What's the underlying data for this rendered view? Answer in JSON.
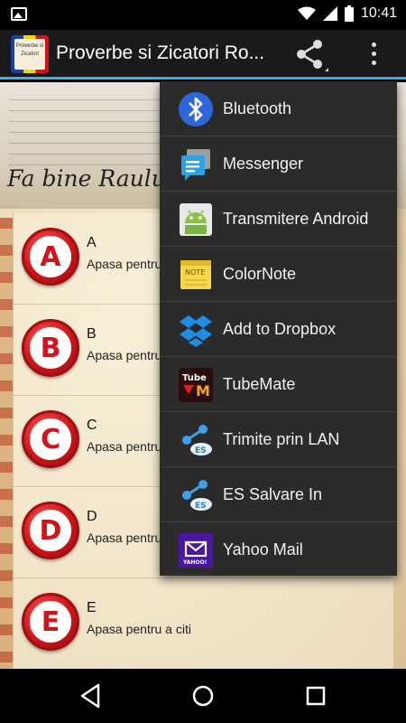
{
  "status_bar": {
    "time": "10:41"
  },
  "app": {
    "title": "Proverbe si Zicatori Ro...",
    "icon_text": "Proverbe si Zicatori"
  },
  "banner": {
    "text": "Fa bine Raulu",
    "end": "!"
  },
  "letters": [
    {
      "letter": "A",
      "title": "A",
      "subtitle": "Apasa pentru"
    },
    {
      "letter": "B",
      "title": "B",
      "subtitle": "Apasa pentru"
    },
    {
      "letter": "C",
      "title": "C",
      "subtitle": "Apasa pentru"
    },
    {
      "letter": "D",
      "title": "D",
      "subtitle": "Apasa pentru"
    },
    {
      "letter": "E",
      "title": "E",
      "subtitle": "Apasa pentru a citi"
    }
  ],
  "share_menu": {
    "items": [
      {
        "label": "Bluetooth",
        "icon": "bluetooth-icon"
      },
      {
        "label": "Messenger",
        "icon": "messenger-icon"
      },
      {
        "label": "Transmitere Android",
        "icon": "android-icon"
      },
      {
        "label": "ColorNote",
        "icon": "colornote-icon"
      },
      {
        "label": "Add to Dropbox",
        "icon": "dropbox-icon"
      },
      {
        "label": "TubeMate",
        "icon": "tubemate-icon"
      },
      {
        "label": "Trimite prin LAN",
        "icon": "es-share-icon"
      },
      {
        "label": "ES Salvare In",
        "icon": "es-save-icon"
      },
      {
        "label": "Yahoo Mail",
        "icon": "yahoo-mail-icon"
      }
    ],
    "tubemate_icon_text": {
      "top": "Tube",
      "bottom": "M"
    },
    "colornote_icon_text": "NOTE",
    "yahoo_icon_text": "YAHOO!",
    "es_badge_text": "ES"
  },
  "colors": {
    "accent": "#33b5e5",
    "menu_bg": "#2b2b2b",
    "badge_red": "#d0161a"
  }
}
